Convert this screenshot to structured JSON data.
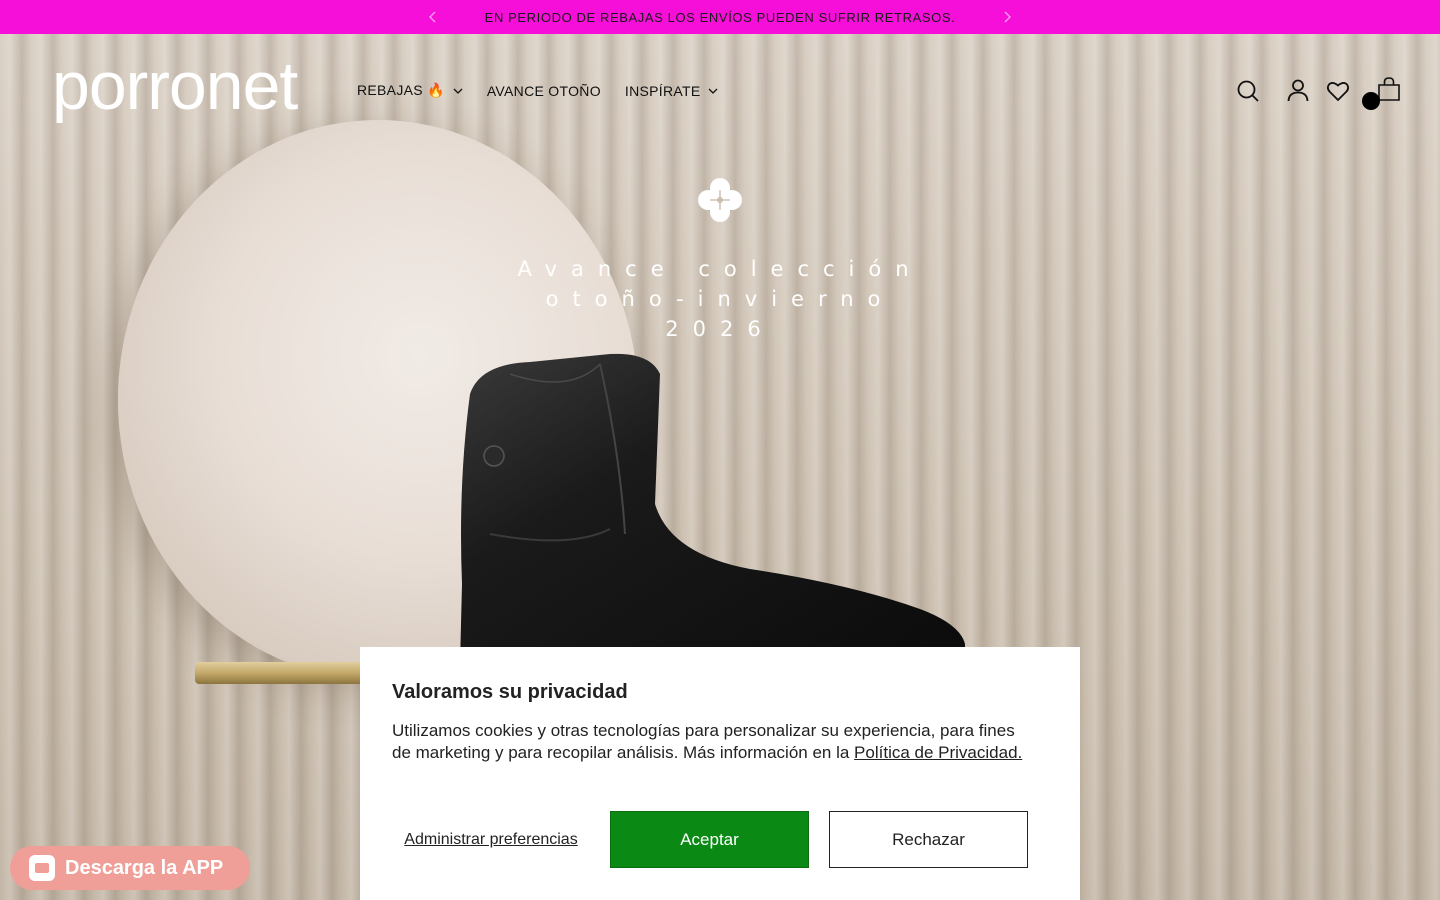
{
  "announcement": {
    "text": "EN PERIODO DE REBAJAS LOS ENVÍOS PUEDEN SUFRIR RETRASOS.",
    "color": "#f50fd9"
  },
  "header": {
    "logo": "porronet",
    "nav": [
      {
        "label": "REBAJAS 🔥",
        "has_dropdown": true
      },
      {
        "label": "AVANCE OTOÑO",
        "has_dropdown": false
      },
      {
        "label": "INSPÍRATE",
        "has_dropdown": true
      }
    ],
    "icons": [
      "search-icon",
      "account-icon",
      "wishlist-icon",
      "cart-icon"
    ]
  },
  "hero": {
    "title_lines": [
      "Avance colección",
      "otoño-invierno",
      "2026"
    ]
  },
  "cookie": {
    "title": "Valoramos su privacidad",
    "text": "Utilizamos cookies y otras tecnologías para personalizar su experiencia, para fines de marketing y para recopilar análisis. Más información en la ",
    "link": "Política de Privacidad.",
    "manage": "Administrar preferencias",
    "accept": "Aceptar",
    "reject": "Rechazar",
    "accept_color": "#0a8a14"
  },
  "app_badge": {
    "label": "Descarga la APP",
    "color": "#ef9f97"
  }
}
